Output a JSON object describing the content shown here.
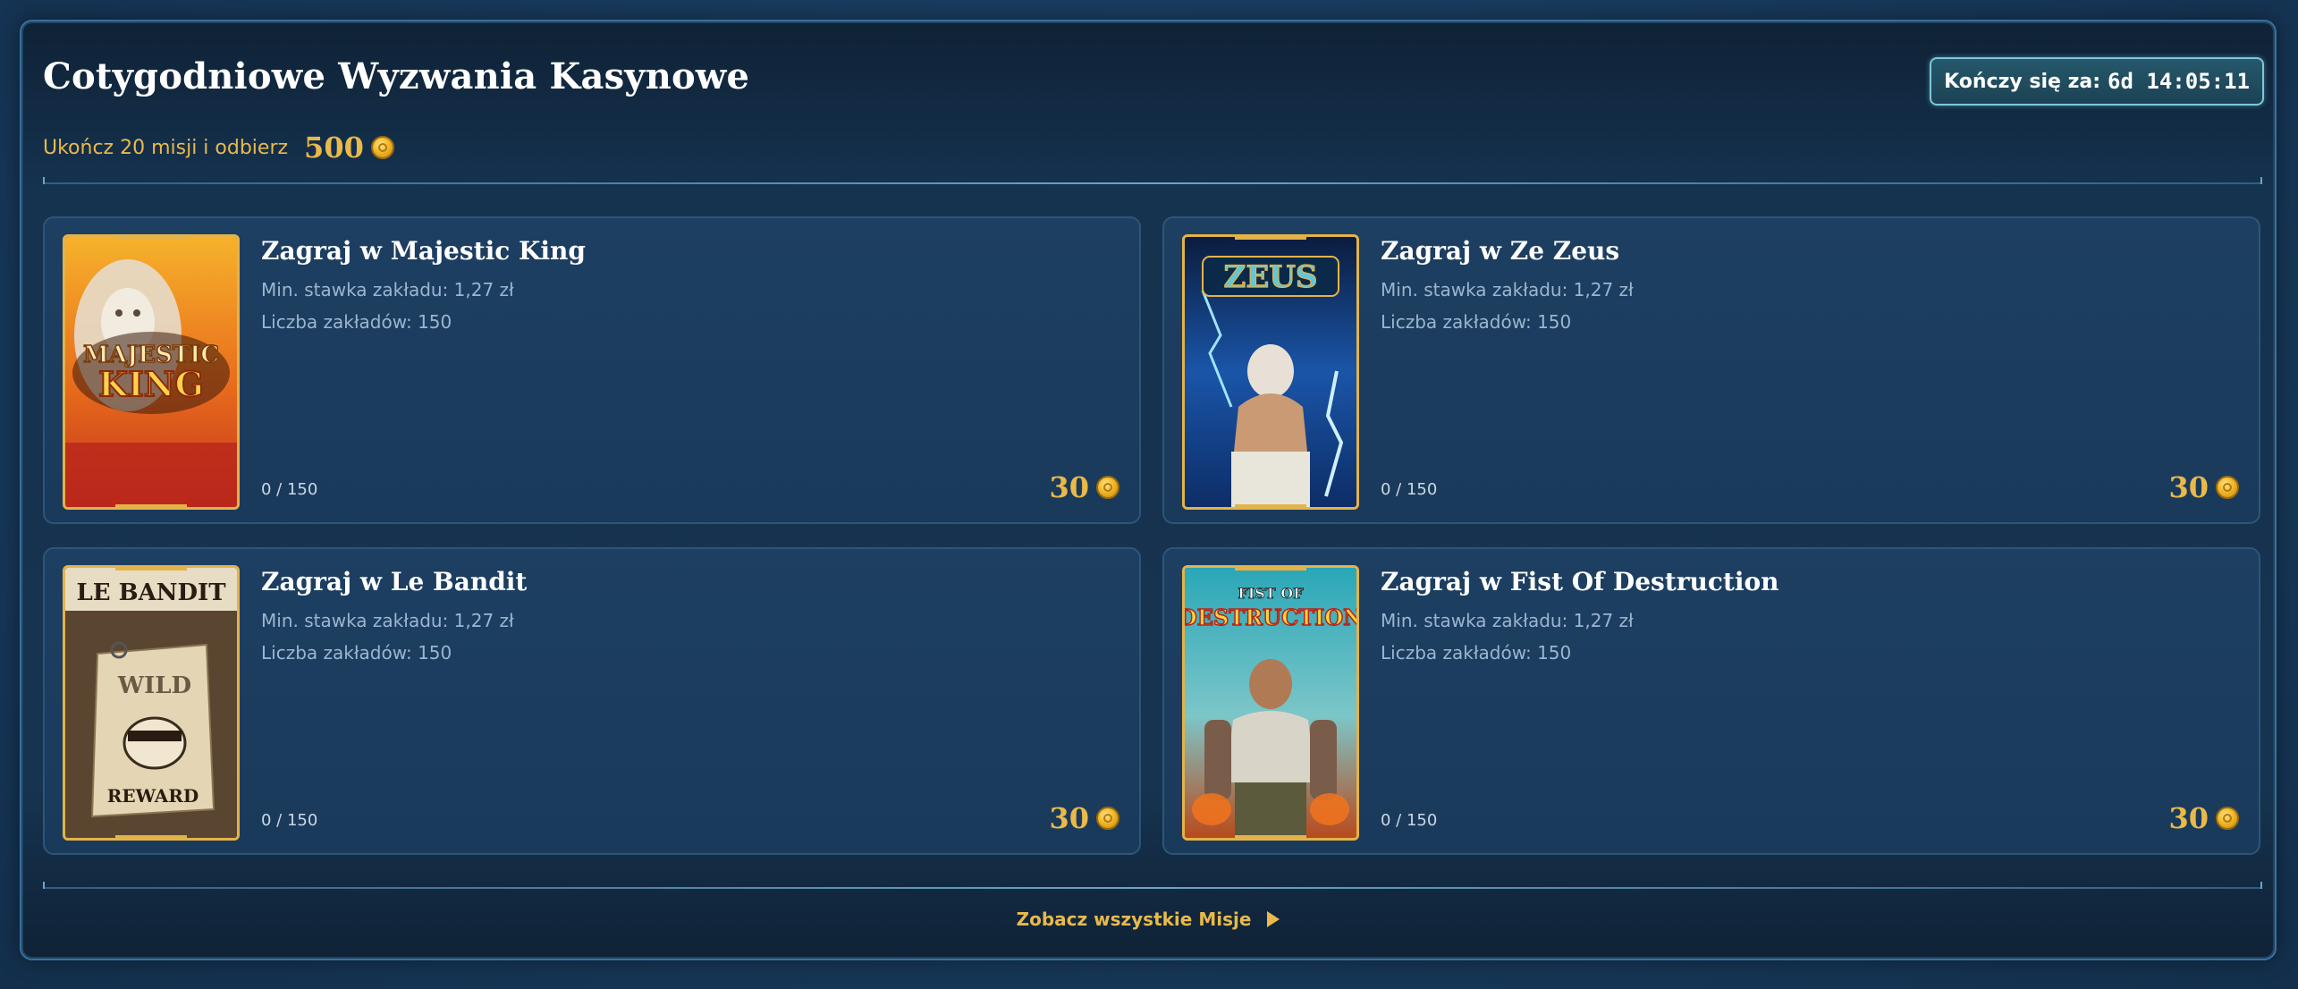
{
  "header": {
    "title": "Cotygodniowe Wyzwania Kasynowe",
    "subtitle": "Ukończ 20 misji i odbierz",
    "total_reward": "500",
    "timer_label": "Kończy się za:",
    "timer_value": "6d 14:05:11"
  },
  "missions": [
    {
      "title": "Zagraj w Majestic King",
      "min_bet": "Min. stawka zakładu: 1,27 zł",
      "bet_count": "Liczba zakładów: 150",
      "progress": "0 / 150",
      "reward": "30",
      "thumb_text_1": "MAJESTIC",
      "thumb_text_2": "KING"
    },
    {
      "title": "Zagraj w Ze Zeus",
      "min_bet": "Min. stawka zakładu: 1,27 zł",
      "bet_count": "Liczba zakładów: 150",
      "progress": "0 / 150",
      "reward": "30",
      "thumb_text_1": "ZEUS"
    },
    {
      "title": "Zagraj w Le Bandit",
      "min_bet": "Min. stawka zakładu: 1,27 zł",
      "bet_count": "Liczba zakładów: 150",
      "progress": "0 / 150",
      "reward": "30",
      "thumb_text_1": "LE BANDIT",
      "thumb_text_2": "WILD",
      "thumb_text_3": "REWARD"
    },
    {
      "title": "Zagraj w Fist Of Destruction",
      "min_bet": "Min. stawka zakładu: 1,27 zł",
      "bet_count": "Liczba zakładów: 150",
      "progress": "0 / 150",
      "reward": "30",
      "thumb_text_1": "FIST OF",
      "thumb_text_2": "DESTRUCTION"
    }
  ],
  "footer": {
    "see_all": "Zobacz wszystkie Misje"
  },
  "colors": {
    "accent_gold": "#e9b94b",
    "timer_border": "#7ac9d8",
    "card_bg": "#1d3f61"
  }
}
